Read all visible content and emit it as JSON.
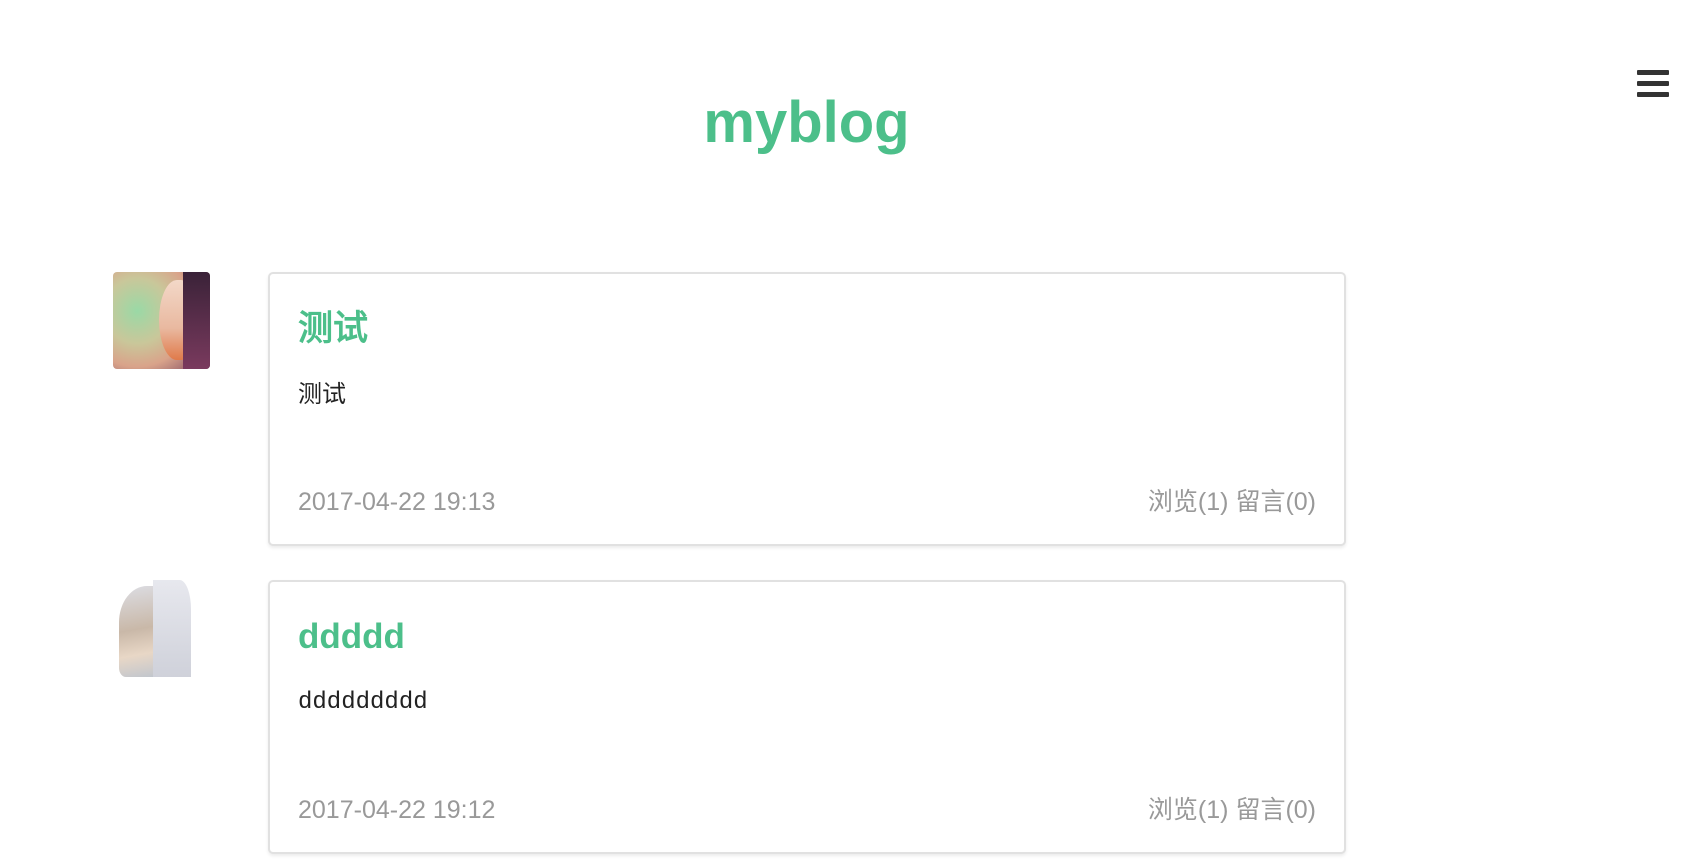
{
  "header": {
    "site_title": "myblog",
    "menu_icon": "hamburger-menu-icon"
  },
  "posts": [
    {
      "title": "测试",
      "excerpt": "测试",
      "date": "2017-04-22 19:13",
      "views_label": "浏览(1)",
      "comments_label": "留言(0)"
    },
    {
      "title": "ddddd",
      "excerpt": "ddddddddd",
      "date": "2017-04-22 19:12",
      "views_label": "浏览(1)",
      "comments_label": "留言(0)"
    }
  ],
  "colors": {
    "accent": "#4cbf8a",
    "meta_text": "#999999",
    "card_border": "#e1e1e1"
  }
}
